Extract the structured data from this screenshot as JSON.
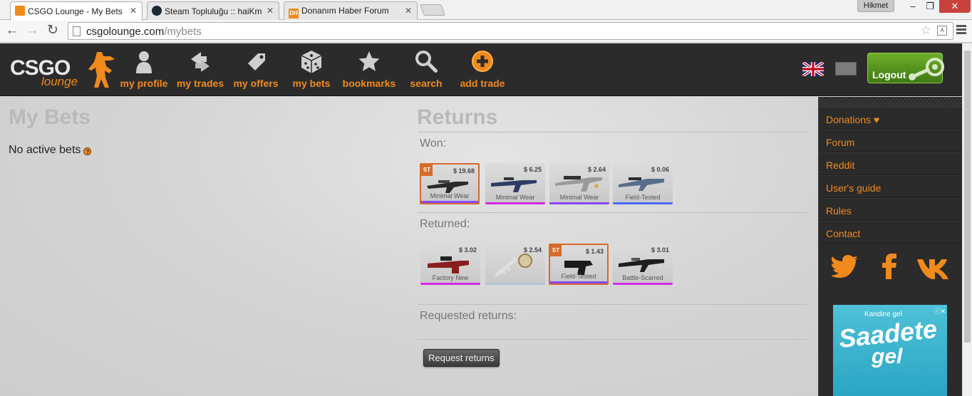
{
  "browser": {
    "tabs": [
      {
        "title": "CSGO Lounge - My Bets",
        "active": true
      },
      {
        "title": "Steam Topluluğu :: haiKm",
        "active": false
      },
      {
        "title": "Donanım Haber Forum",
        "active": false
      }
    ],
    "dh_favicon": "DH",
    "profile_name": "Hikmet",
    "url_host": "csgolounge.com",
    "url_path": "/mybets"
  },
  "site": {
    "logo_main": "CSGO",
    "logo_sub": "lounge",
    "nav": [
      {
        "label": "my profile",
        "icon": "profile-icon"
      },
      {
        "label": "my trades",
        "icon": "trades-icon"
      },
      {
        "label": "my offers",
        "icon": "offers-icon"
      },
      {
        "label": "my bets",
        "icon": "dice-icon"
      },
      {
        "label": "bookmarks",
        "icon": "star-icon"
      },
      {
        "label": "search",
        "icon": "search-icon"
      },
      {
        "label": "add trade",
        "icon": "plus-icon"
      }
    ],
    "logout_label": "Logout"
  },
  "mybets": {
    "title": "My Bets",
    "no_active": "No active bets",
    "help_glyph": "?"
  },
  "returns": {
    "title": "Returns",
    "won_label": "Won:",
    "returned_label": "Returned:",
    "requested_label": "Requested returns:",
    "request_button": "Request returns",
    "won_items": [
      {
        "price": "$ 19.68",
        "condition": "Minimal Wear",
        "stattrak": true,
        "rarity_color": "#8847ff"
      },
      {
        "price": "$ 6.25",
        "condition": "Minimal Wear",
        "stattrak": false,
        "rarity_color": "#d32ce6"
      },
      {
        "price": "$ 2.64",
        "condition": "Minimal Wear",
        "stattrak": false,
        "rarity_color": "#8847ff"
      },
      {
        "price": "$ 0.06",
        "condition": "Field-Tested",
        "stattrak": false,
        "rarity_color": "#4b69ff"
      }
    ],
    "returned_items": [
      {
        "price": "$ 3.02",
        "condition": "Factory New",
        "stattrak": false,
        "rarity_color": "#d32ce6"
      },
      {
        "price": "$ 2.54",
        "condition": "",
        "stattrak": false,
        "rarity_color": "#b0c3d9"
      },
      {
        "price": "$ 1.43",
        "condition": "Field-Tested",
        "stattrak": true,
        "rarity_color": "#8847ff"
      },
      {
        "price": "$ 3.01",
        "condition": "Battle-Scarred",
        "stattrak": false,
        "rarity_color": "#d32ce6"
      }
    ],
    "stattrak_label": "ST"
  },
  "sidebar": {
    "links": [
      "Donations ♥",
      "Forum",
      "Reddit",
      "User's guide",
      "Rules",
      "Contact"
    ],
    "social": [
      "twitter-icon",
      "facebook-icon",
      "vk-icon"
    ]
  },
  "ad": {
    "line1": "Kandine gel",
    "line2": "Saadete",
    "line3": "gel"
  },
  "colors": {
    "accent": "#f08a1c",
    "header_bg": "#2b2b2b",
    "logout_green": "#5a9a1f",
    "stattrak": "#d66a2a"
  }
}
